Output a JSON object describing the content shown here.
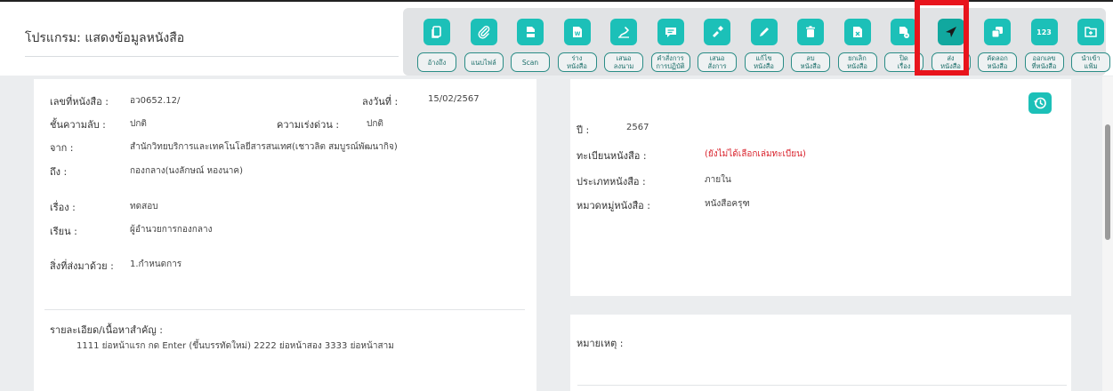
{
  "app": {
    "title": "โปรแกรม: แสดงข้อมูลหนังสือ"
  },
  "toolbar": [
    {
      "id": "refer",
      "label": "อ้างถึง",
      "icon": "copy-icon"
    },
    {
      "id": "attach",
      "label": "แนบไฟล์",
      "icon": "paperclip-icon"
    },
    {
      "id": "scan",
      "label": "Scan",
      "icon": "scanner-icon"
    },
    {
      "id": "draft",
      "label": "ร่าง\nหนังสือ",
      "icon": "word-doc-icon"
    },
    {
      "id": "sign",
      "label": "เสนอ\nลงนาม",
      "icon": "sign-hand-icon"
    },
    {
      "id": "order",
      "label": "คำสั่งการ\nการปฏิบัติ",
      "icon": "message-icon"
    },
    {
      "id": "propose",
      "label": "เสนอ\nสั่งการ",
      "icon": "hand-pen-icon"
    },
    {
      "id": "edit",
      "label": "แก้ไข\nหนังสือ",
      "icon": "pencil-icon"
    },
    {
      "id": "delete",
      "label": "ลบ\nหนังสือ",
      "icon": "trash-icon"
    },
    {
      "id": "cancel",
      "label": "ยกเลิก\nหนังสือ",
      "icon": "doc-cancel-icon"
    },
    {
      "id": "close",
      "label": "ปิด\nเรื่อง",
      "icon": "doc-close-icon"
    },
    {
      "id": "send",
      "label": "ส่ง\nหนังสือ",
      "icon": "paper-plane-icon",
      "active": true
    },
    {
      "id": "copydoc",
      "label": "คัดลอก\nหนังสือ",
      "icon": "duplicate-icon"
    },
    {
      "id": "number",
      "label": "ออกเลข\nที่หนังสือ",
      "icon": "number-123-icon",
      "icon_text": "123"
    },
    {
      "id": "import",
      "label": "นำเข้า\nแฟ้ม",
      "icon": "folder-import-icon"
    }
  ],
  "doc": {
    "number_label": "เลขที่หนังสือ :",
    "number_value": "อว0652.12/",
    "date_label": "ลงวันที่ :",
    "date_value": "15/02/2567",
    "secret_label": "ชั้นความลับ :",
    "secret_value": "ปกติ",
    "urgency_label": "ความเร่งด่วน :",
    "urgency_value": "ปกติ",
    "from_label": "จาก :",
    "from_value": "สำนักวิทยบริการและเทคโนโลยีสารสนเทศ(เชาวลิต สมบูรณ์พัฒนากิจ)",
    "to_label": "ถึง :",
    "to_value": "กองกลาง(นงลักษณ์ หองนาค)",
    "subject_label": "เรื่อง :",
    "subject_value": "ทดสอบ",
    "attn_label": "เรียน :",
    "attn_value": "ผู้อำนวยการกองกลาง",
    "enclosure_label": "สิ่งที่ส่งมาด้วย :",
    "enclosure_value": "1.กำหนดการ",
    "detail_label": "รายละเอียด/เนื้อหาสำคัญ :",
    "detail_value": "1111 ย่อหน้าแรก กด Enter (ขึ้นบรรทัดใหม่) 2222 ย่อหน้าสอง 3333 ย่อหน้าสาม"
  },
  "meta": {
    "year_label": "ปี :",
    "year_value": "2567",
    "register_label": "ทะเบียนหนังสือ :",
    "register_value": "(ยังไม่ได้เลือกเล่มทะเบียน)",
    "type_label": "ประเภทหนังสือ :",
    "type_value": "ภายใน",
    "category_label": "หมวดหมู่หนังสือ :",
    "category_value": "หนังสือครุฑ"
  },
  "remark": {
    "label": "หมายเหตุ :"
  },
  "colors": {
    "accent": "#1cc0b8",
    "highlight": "#e8141c",
    "alert": "#d9232d"
  }
}
